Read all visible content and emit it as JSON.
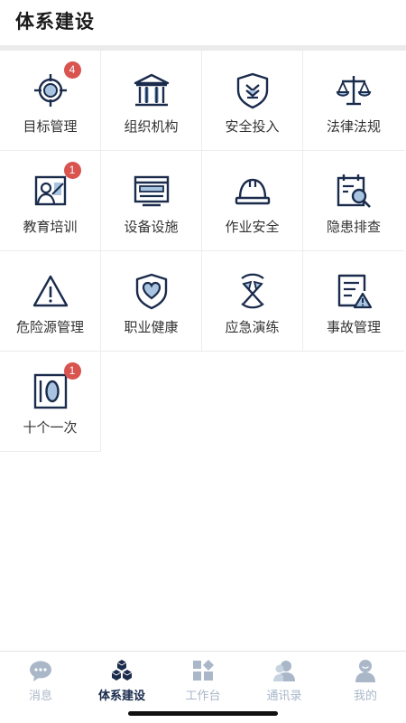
{
  "header": {
    "title": "体系建设"
  },
  "colors": {
    "icon_navy": "#1a2b4c",
    "icon_fill": "#a8c4e0",
    "badge": "#d9534f",
    "tab_inactive": "#a9b7c9"
  },
  "grid": {
    "items": [
      {
        "label": "目标管理",
        "icon": "target-icon",
        "badge": "4"
      },
      {
        "label": "组织机构",
        "icon": "building-icon",
        "badge": ""
      },
      {
        "label": "安全投入",
        "icon": "shield-icon",
        "badge": ""
      },
      {
        "label": "法律法规",
        "icon": "scales-icon",
        "badge": ""
      },
      {
        "label": "教育培训",
        "icon": "training-board-icon",
        "badge": "1"
      },
      {
        "label": "设备设施",
        "icon": "equipment-icon",
        "badge": ""
      },
      {
        "label": "作业安全",
        "icon": "hard-hat-icon",
        "badge": ""
      },
      {
        "label": "隐患排查",
        "icon": "inspection-icon",
        "badge": ""
      },
      {
        "label": "危险源管理",
        "icon": "warning-icon",
        "badge": ""
      },
      {
        "label": "职业健康",
        "icon": "health-shield-icon",
        "badge": ""
      },
      {
        "label": "应急演练",
        "icon": "emergency-drill-icon",
        "badge": ""
      },
      {
        "label": "事故管理",
        "icon": "accident-doc-icon",
        "badge": ""
      },
      {
        "label": "十个一次",
        "icon": "ten-once-icon",
        "badge": "1"
      }
    ]
  },
  "tabbar": {
    "tabs": [
      {
        "label": "消息",
        "icon": "chat-bubble-icon",
        "active": false
      },
      {
        "label": "体系建设",
        "icon": "cubes-icon",
        "active": true
      },
      {
        "label": "工作台",
        "icon": "workbench-icon",
        "active": false
      },
      {
        "label": "通讯录",
        "icon": "contacts-icon",
        "active": false
      },
      {
        "label": "我的",
        "icon": "profile-icon",
        "active": false
      }
    ]
  }
}
